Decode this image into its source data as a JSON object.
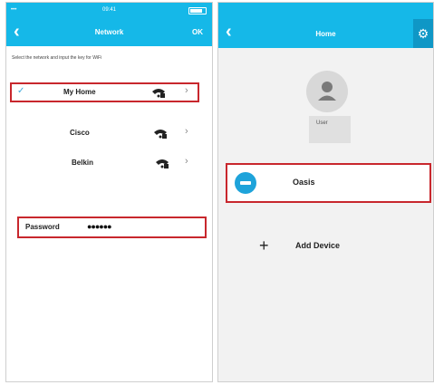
{
  "left_screen": {
    "status_bar": {
      "carrier": "",
      "time": "09:41"
    },
    "nav": {
      "back": "‹",
      "title": "Network",
      "ok": "OK"
    },
    "hint": "Select the network and input the key for WiFi",
    "networks": [
      {
        "name": "My Home",
        "selected": true
      },
      {
        "name": "Cisco",
        "selected": false
      },
      {
        "name": "Belkin",
        "selected": false
      }
    ],
    "password": {
      "label": "Password",
      "value": "●●●●●●"
    }
  },
  "right_screen": {
    "nav": {
      "back": "‹",
      "title": "Home",
      "settings_icon": "gear-icon"
    },
    "user": {
      "label": "User"
    },
    "devices": [
      {
        "name": "Oasis"
      }
    ],
    "add_device": {
      "label": "Add Device"
    }
  },
  "colors": {
    "accent": "#15b8e8",
    "highlight": "#c8272d",
    "device_icon": "#1ea3da"
  }
}
